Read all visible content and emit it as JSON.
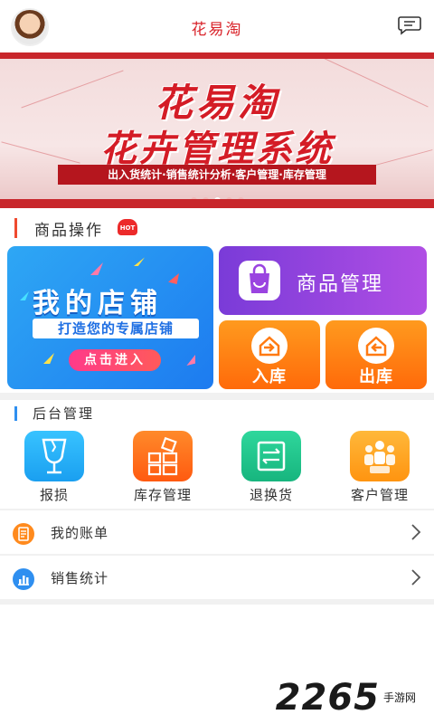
{
  "header": {
    "title": "花易淘",
    "avatar": "avatar",
    "message_icon": "chat-bubble-icon"
  },
  "banner": {
    "title_line1": "花易淘",
    "title_line2": "花卉管理系统",
    "subtitle": "出入货统计·销售统计分析·客户管理·库存管理",
    "slides": 5,
    "active_slide": 3
  },
  "products_section": {
    "title": "商品操作",
    "hot_badge": "HOT",
    "store_card": {
      "title": "我的店铺",
      "subtitle": "打造您的专属店铺",
      "button": "点击进入"
    },
    "goods_card": {
      "label": "商品管理"
    },
    "stock_in_card": {
      "label": "入库"
    },
    "stock_out_card": {
      "label": "出库"
    }
  },
  "backend_section": {
    "title": "后台管理",
    "tools": [
      {
        "label": "报损",
        "icon": "broken-glass-icon",
        "color": "#1fb0f1"
      },
      {
        "label": "库存管理",
        "icon": "grid-boxes-icon",
        "color": "#ff6d1c"
      },
      {
        "label": "退换货",
        "icon": "exchange-icon",
        "color": "#1ec48a"
      },
      {
        "label": "客户管理",
        "icon": "people-icon",
        "color": "#ffa020"
      }
    ]
  },
  "list": [
    {
      "label": "我的账单",
      "icon": "bill-icon",
      "color": "#ff8a1d"
    },
    {
      "label": "销售统计",
      "icon": "stats-icon",
      "color": "#2f8ff0"
    }
  ],
  "watermark": {
    "number": "2265",
    "text": "手游网"
  },
  "colors": {
    "brand_red": "#d9232a",
    "accent": "#ef4a2f"
  }
}
